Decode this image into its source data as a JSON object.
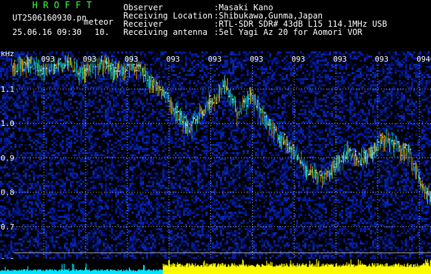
{
  "header": {
    "app_title": "HROFFT",
    "filename": "UT2506160930.pn",
    "mode": "meteor",
    "datetime": "25.06.16 09:30",
    "step": "10.",
    "info": [
      {
        "label": "Observer",
        "value": ":Masaki Kano"
      },
      {
        "label": "Receiving Location",
        "value": ":Shibukawa,Gunma,Japan"
      },
      {
        "label": "Receiver",
        "value": ":RTL-SDR SDR# 43dB L15 114.1MHz USB"
      },
      {
        "label": "Receiving antenna",
        "value": ":5el Yagi Az 20 for Aomori VOR"
      }
    ]
  },
  "colors": {
    "background": "#000000",
    "grid": "#dcdcdc",
    "header_title": "#39ff39",
    "header_text": "#ffffff",
    "noise_floor": "#000c70",
    "baseline_cyan": "#00e5ff",
    "baseline_yellow": "#ffff00"
  },
  "chart_data": {
    "type": "heatmap",
    "title": "",
    "xlabel": "",
    "ylabel": "kHz",
    "ylim": [
      0.6,
      1.2
    ],
    "xlim": [
      0,
      10
    ],
    "y_ticks": [
      "1.1",
      "1.0",
      "0.9",
      "0.8",
      "0.7",
      "0.6"
    ],
    "x_ticks": [
      "093",
      "093",
      "093",
      "093",
      "093",
      "093",
      "093",
      "093",
      "093",
      "0940"
    ],
    "traces": [
      {
        "name": "",
        "x": [
          0.0,
          0.3,
          0.6,
          0.9,
          1.2,
          1.5,
          1.8,
          2.1,
          2.4,
          2.7,
          3.0,
          3.3,
          3.6,
          3.9,
          4.2,
          4.5,
          4.8,
          5.1,
          5.4,
          5.7,
          6.0,
          6.3,
          6.6,
          6.9,
          7.2,
          7.5,
          7.8,
          8.1,
          8.4,
          8.7,
          9.0,
          9.3,
          9.6,
          9.8,
          10.0
        ],
        "y": [
          1.17,
          1.18,
          1.16,
          1.17,
          1.18,
          1.15,
          1.17,
          1.18,
          1.16,
          1.17,
          1.17,
          1.12,
          1.08,
          1.03,
          0.99,
          1.04,
          1.07,
          1.12,
          1.03,
          1.09,
          1.03,
          0.98,
          0.94,
          0.9,
          0.86,
          0.85,
          0.88,
          0.92,
          0.9,
          0.92,
          0.96,
          0.94,
          0.92,
          0.87,
          0.8
        ]
      }
    ],
    "baseline": [
      {
        "x_range": [
          0.0,
          3.55
        ],
        "color": "cyan"
      },
      {
        "x_range": [
          3.55,
          10.0
        ],
        "color": "yellow"
      }
    ]
  }
}
